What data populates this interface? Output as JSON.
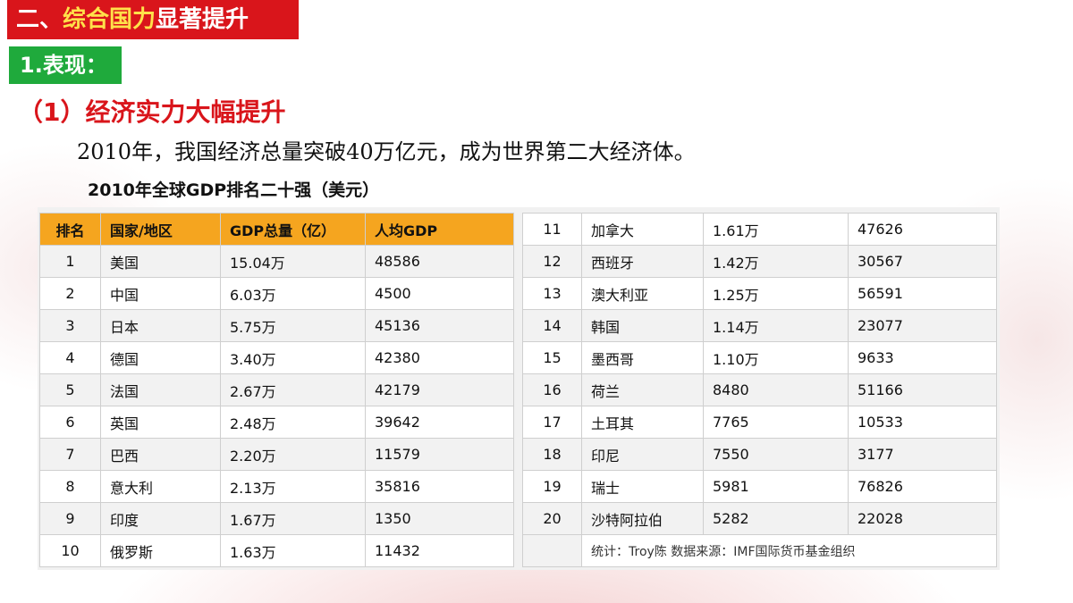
{
  "header": {
    "title_prefix": "二、",
    "title_highlight": "综合国力",
    "title_suffix": "显著提升"
  },
  "section": {
    "badge": "1.表现：",
    "point": "（1）经济实力大幅提升",
    "intro": "2010年，我国经济总量突破40万亿元，成为世界第二大经济体。"
  },
  "table": {
    "title": "2010年全球GDP排名二十强（美元）",
    "headers": {
      "rank": "排名",
      "country": "国家/地区",
      "gdp": "GDP总量（亿）",
      "per_capita": "人均GDP"
    },
    "left_rows": [
      {
        "rank": "1",
        "country": "美国",
        "gdp": "15.04万",
        "per_capita": "48586"
      },
      {
        "rank": "2",
        "country": "中国",
        "gdp": "6.03万",
        "per_capita": "4500"
      },
      {
        "rank": "3",
        "country": "日本",
        "gdp": "5.75万",
        "per_capita": "45136"
      },
      {
        "rank": "4",
        "country": "德国",
        "gdp": "3.40万",
        "per_capita": "42380"
      },
      {
        "rank": "5",
        "country": "法国",
        "gdp": "2.67万",
        "per_capita": "42179"
      },
      {
        "rank": "6",
        "country": "英国",
        "gdp": "2.48万",
        "per_capita": "39642"
      },
      {
        "rank": "7",
        "country": "巴西",
        "gdp": "2.20万",
        "per_capita": "11579"
      },
      {
        "rank": "8",
        "country": "意大利",
        "gdp": "2.13万",
        "per_capita": "35816"
      },
      {
        "rank": "9",
        "country": "印度",
        "gdp": "1.67万",
        "per_capita": "1350"
      },
      {
        "rank": "10",
        "country": "俄罗斯",
        "gdp": "1.63万",
        "per_capita": "11432"
      }
    ],
    "right_rows": [
      {
        "rank": "11",
        "country": "加拿大",
        "gdp": "1.61万",
        "per_capita": "47626"
      },
      {
        "rank": "12",
        "country": "西班牙",
        "gdp": "1.42万",
        "per_capita": "30567"
      },
      {
        "rank": "13",
        "country": "澳大利亚",
        "gdp": "1.25万",
        "per_capita": "56591"
      },
      {
        "rank": "14",
        "country": "韩国",
        "gdp": "1.14万",
        "per_capita": "23077"
      },
      {
        "rank": "15",
        "country": "墨西哥",
        "gdp": "1.10万",
        "per_capita": "9633"
      },
      {
        "rank": "16",
        "country": "荷兰",
        "gdp": "8480",
        "per_capita": "51166"
      },
      {
        "rank": "17",
        "country": "土耳其",
        "gdp": "7765",
        "per_capita": "10533"
      },
      {
        "rank": "18",
        "country": "印尼",
        "gdp": "7550",
        "per_capita": "3177"
      },
      {
        "rank": "19",
        "country": "瑞士",
        "gdp": "5981",
        "per_capita": "76826"
      },
      {
        "rank": "20",
        "country": "沙特阿拉伯",
        "gdp": "5282",
        "per_capita": "22028"
      }
    ],
    "source_note": "统计：Troy陈 数据来源：IMF国际货币基金组织"
  },
  "colors": {
    "title_bar": "#d9151b",
    "title_highlight": "#ffe14a",
    "badge": "#1faa3c",
    "heading_red": "#d9151b",
    "table_header": "#f5a51f"
  }
}
